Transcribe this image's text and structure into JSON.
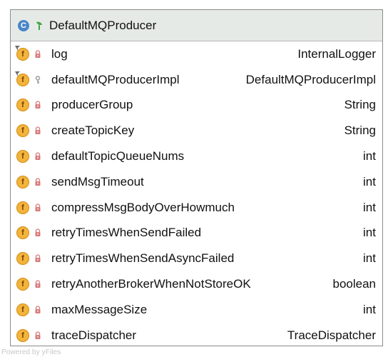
{
  "class": {
    "name": "DefaultMQProducer",
    "icon_letter": "C",
    "icon": "class-icon",
    "accent": "#4a87c9"
  },
  "fields": [
    {
      "letter": "f",
      "name": "log",
      "type": "InternalLogger",
      "access": "private",
      "static": true
    },
    {
      "letter": "f",
      "name": "defaultMQProducerImpl",
      "type": "DefaultMQProducerImpl",
      "access": "protected",
      "static": true
    },
    {
      "letter": "f",
      "name": "producerGroup",
      "type": "String",
      "access": "private",
      "static": false
    },
    {
      "letter": "f",
      "name": "createTopicKey",
      "type": "String",
      "access": "private",
      "static": false
    },
    {
      "letter": "f",
      "name": "defaultTopicQueueNums",
      "type": "int",
      "access": "private",
      "static": false
    },
    {
      "letter": "f",
      "name": "sendMsgTimeout",
      "type": "int",
      "access": "private",
      "static": false
    },
    {
      "letter": "f",
      "name": "compressMsgBodyOverHowmuch",
      "type": "int",
      "access": "private",
      "static": false
    },
    {
      "letter": "f",
      "name": "retryTimesWhenSendFailed",
      "type": "int",
      "access": "private",
      "static": false
    },
    {
      "letter": "f",
      "name": "retryTimesWhenSendAsyncFailed",
      "type": "int",
      "access": "private",
      "static": false
    },
    {
      "letter": "f",
      "name": "retryAnotherBrokerWhenNotStoreOK",
      "type": "boolean",
      "access": "private",
      "static": false
    },
    {
      "letter": "f",
      "name": "maxMessageSize",
      "type": "int",
      "access": "private",
      "static": false
    },
    {
      "letter": "f",
      "name": "traceDispatcher",
      "type": "TraceDispatcher",
      "access": "private",
      "static": false
    }
  ],
  "colors": {
    "header_bg": "#e6eae7",
    "border": "#8c8c8c",
    "field_icon": "#f2b43b",
    "private_lock": "#d77b7b",
    "protected_key": "#9a9a9a",
    "leaf": "#44a346"
  },
  "footer": {
    "text": "Powered by yFiles"
  }
}
